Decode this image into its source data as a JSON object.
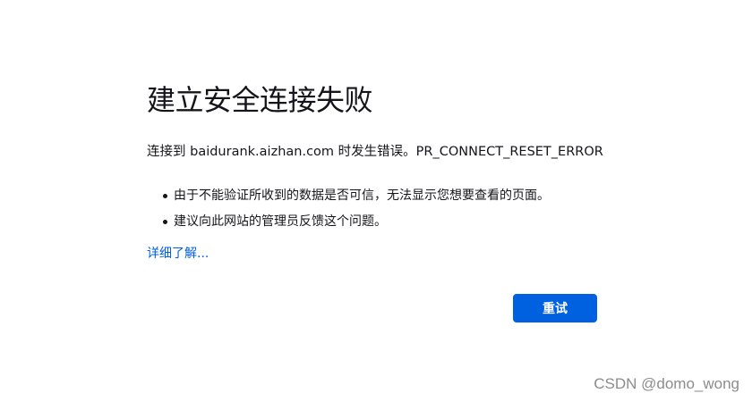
{
  "error": {
    "title": "建立安全连接失败",
    "description": "连接到 baidurank.aizhan.com 时发生错误。PR_CONNECT_RESET_ERROR",
    "reasons": [
      "由于不能验证所收到的数据是否可信，无法显示您想要查看的页面。",
      "建议向此网站的管理员反馈这个问题。"
    ],
    "learn_more_label": "详细了解...",
    "retry_label": "重试"
  },
  "watermark": "CSDN @domo_wong",
  "colors": {
    "text": "#15141a",
    "accent": "#0061e0",
    "watermark": "#8c8c8c",
    "background": "#ffffff"
  }
}
